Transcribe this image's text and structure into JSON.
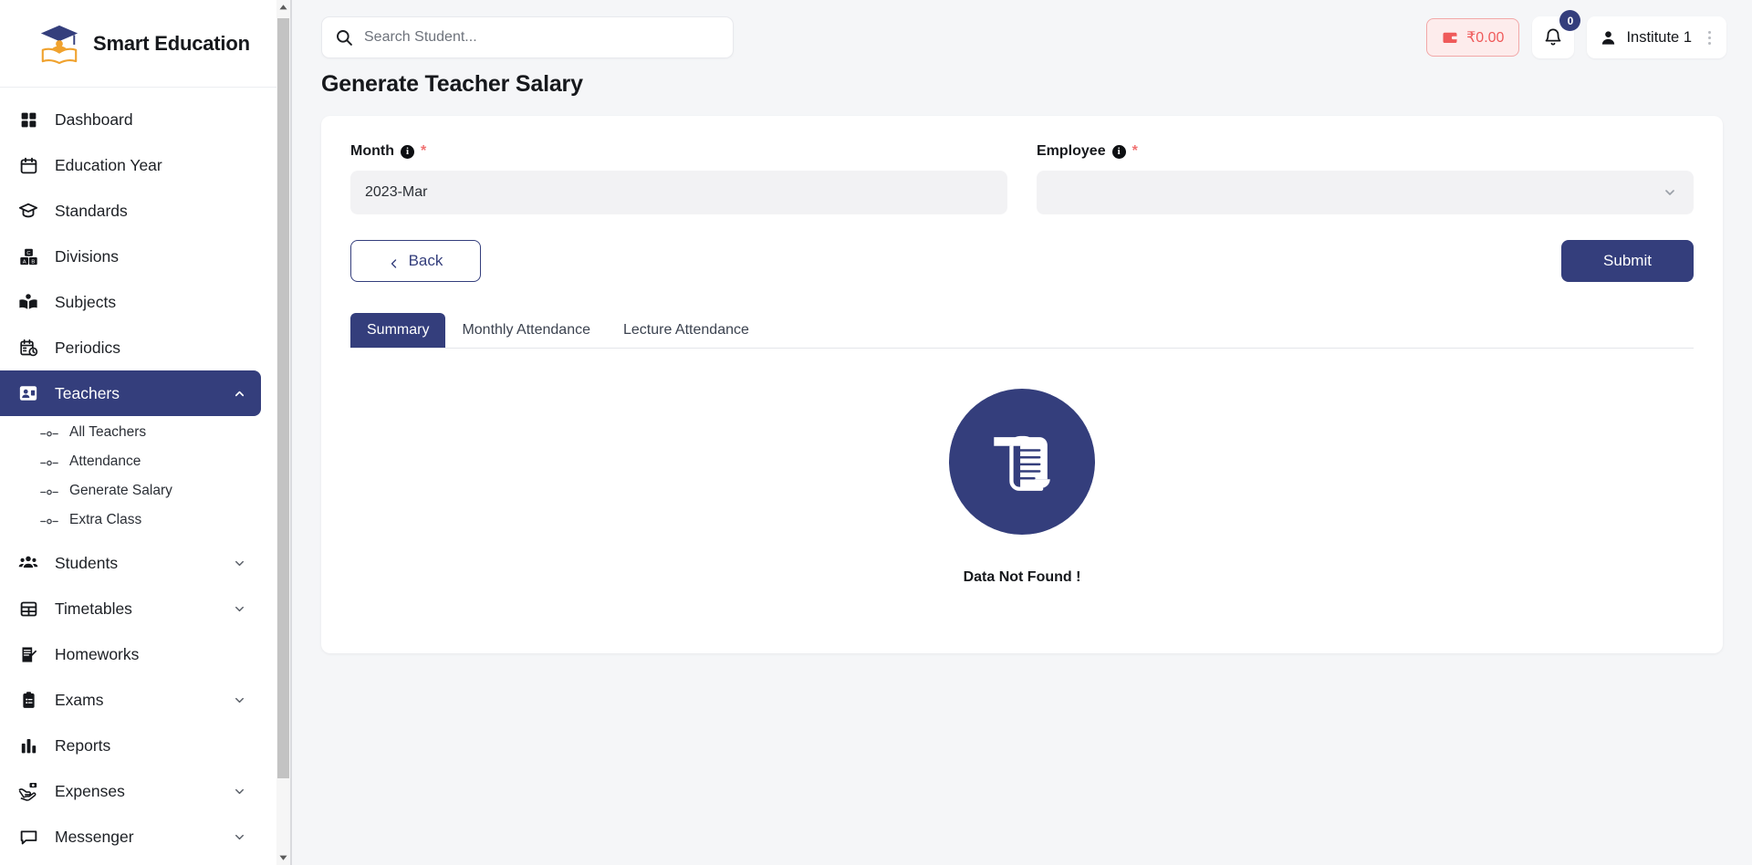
{
  "brand": {
    "name": "Smart Education",
    "logo_icon": "graduation-cap-logo"
  },
  "sidebar": {
    "items": [
      {
        "label": "Dashboard",
        "icon": "grid-icon",
        "expandable": false,
        "active": false
      },
      {
        "label": "Education Year",
        "icon": "calendar-icon",
        "expandable": false,
        "active": false
      },
      {
        "label": "Standards",
        "icon": "graduation-cap-icon",
        "expandable": false,
        "active": false
      },
      {
        "label": "Divisions",
        "icon": "blocks-icon",
        "expandable": false,
        "active": false
      },
      {
        "label": "Subjects",
        "icon": "book-icon",
        "expandable": false,
        "active": false
      },
      {
        "label": "Periodics",
        "icon": "calendar-clock-icon",
        "expandable": false,
        "active": false
      },
      {
        "label": "Teachers",
        "icon": "teacher-board-icon",
        "expandable": true,
        "expanded": true,
        "active": true
      },
      {
        "label": "Students",
        "icon": "users-icon",
        "expandable": true,
        "expanded": false,
        "active": false
      },
      {
        "label": "Timetables",
        "icon": "table-icon",
        "expandable": true,
        "expanded": false,
        "active": false
      },
      {
        "label": "Homeworks",
        "icon": "note-edit-icon",
        "expandable": false,
        "active": false
      },
      {
        "label": "Exams",
        "icon": "clipboard-icon",
        "expandable": true,
        "expanded": false,
        "active": false
      },
      {
        "label": "Reports",
        "icon": "bar-chart-icon",
        "expandable": false,
        "active": false
      },
      {
        "label": "Expenses",
        "icon": "money-hand-icon",
        "expandable": true,
        "expanded": false,
        "active": false
      },
      {
        "label": "Messenger",
        "icon": "chat-icon",
        "expandable": true,
        "expanded": false,
        "active": false
      }
    ],
    "teachers_submenu": [
      {
        "label": "All Teachers"
      },
      {
        "label": "Attendance"
      },
      {
        "label": "Generate Salary"
      },
      {
        "label": "Extra Class"
      }
    ]
  },
  "topbar": {
    "search": {
      "placeholder": "Search Student...",
      "value": "",
      "icon": "search-icon"
    },
    "wallet": {
      "amount": "₹0.00",
      "icon": "wallet-icon"
    },
    "notifications": {
      "count": "0",
      "icon": "bell-icon"
    },
    "user": {
      "name": "Institute 1",
      "icon": "person-icon",
      "menu_icon": "kebab-menu-icon"
    }
  },
  "page": {
    "title": "Generate Teacher Salary"
  },
  "form": {
    "month": {
      "label": "Month",
      "value": "2023-Mar",
      "required_marker": "*",
      "info_glyph": "i"
    },
    "employee": {
      "label": "Employee",
      "value": "",
      "required_marker": "*",
      "info_glyph": "i",
      "chevron_icon": "chevron-down-icon"
    },
    "back_button": {
      "label": "Back",
      "icon": "chevron-left-icon"
    },
    "submit_button": {
      "label": "Submit"
    }
  },
  "tabs": [
    {
      "label": "Summary",
      "active": true
    },
    {
      "label": "Monthly Attendance",
      "active": false
    },
    {
      "label": "Lecture Attendance",
      "active": false
    }
  ],
  "empty_state": {
    "message": "Data Not Found !",
    "icon": "scroll-document-icon"
  },
  "colors": {
    "accent": "#343e7c",
    "danger": "#ef5a5a",
    "page_bg": "#f5f6f8",
    "field_bg": "#f2f2f4"
  }
}
